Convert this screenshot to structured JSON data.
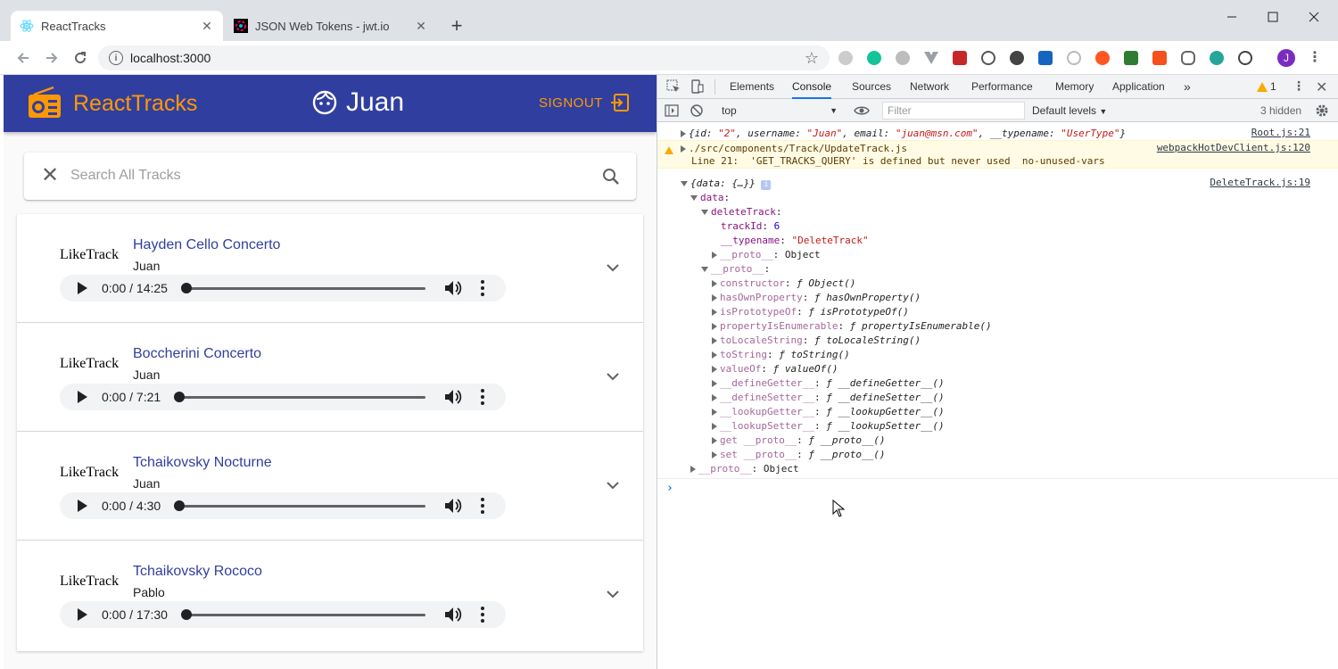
{
  "browser": {
    "tabs": [
      {
        "title": "ReactTracks",
        "active": true
      },
      {
        "title": "JSON Web Tokens - jwt.io",
        "active": false
      }
    ],
    "url": "localhost:3000",
    "profile_initial": "J"
  },
  "app": {
    "brand": "ReactTracks",
    "username": "Juan",
    "signout_label": "SIGNOUT",
    "search_placeholder": "Search All Tracks",
    "colors": {
      "appbar": "#303f9f",
      "accent": "#ff9800"
    },
    "tracks": [
      {
        "like": "LikeTrack",
        "title": "Hayden Cello Concerto",
        "user": "Juan",
        "time": "0:00 / 14:25",
        "progress": 0
      },
      {
        "like": "LikeTrack",
        "title": "Boccherini Concerto",
        "user": "Juan",
        "time": "0:00 / 7:21",
        "progress": 0
      },
      {
        "like": "LikeTrack",
        "title": "Tchaikovsky Nocturne",
        "user": "Juan",
        "time": "0:00 / 4:30",
        "progress": 0
      },
      {
        "like": "LikeTrack",
        "title": "Tchaikovsky Rococo",
        "user": "Pablo",
        "time": "0:00 / 17:30",
        "progress": 0
      }
    ]
  },
  "devtools": {
    "tabs": [
      "Elements",
      "Console",
      "Sources",
      "Network",
      "Performance",
      "Memory",
      "Application"
    ],
    "active_tab": "Console",
    "warning_count": "1",
    "context": "top",
    "filter_placeholder": "Filter",
    "levels": "Default levels",
    "hidden": "3 hidden",
    "logs": {
      "root_src": "Root.js:21",
      "warn_path": "./src/components/Track/UpdateTrack.js",
      "warn_msg": "Line 21:  'GET_TRACKS_QUERY' is defined but never used  no-unused-vars",
      "warn_src": "webpackHotDevClient.js:120",
      "delete_src": "DeleteTrack.js:19"
    }
  }
}
